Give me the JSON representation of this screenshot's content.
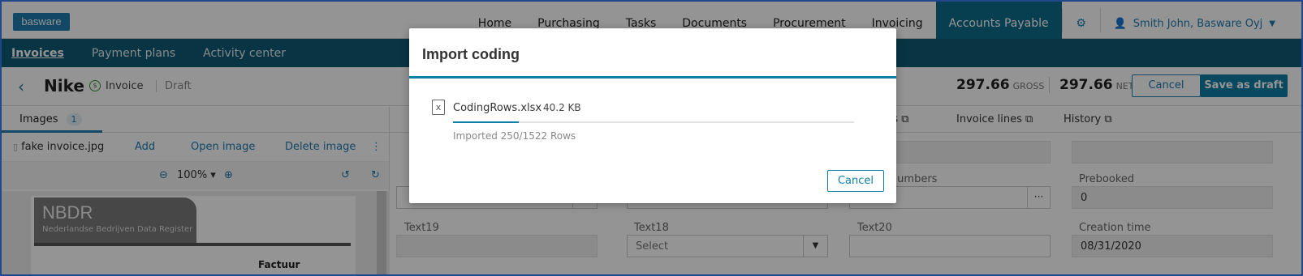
{
  "app": {
    "logo": "basware"
  },
  "topnav": {
    "items": [
      "Home",
      "Purchasing",
      "Tasks",
      "Documents",
      "Procurement",
      "Invoicing",
      "Accounts Payable"
    ],
    "active": "Accounts Payable",
    "user": "Smith John, Basware Oyj"
  },
  "subnav": {
    "items": [
      "Invoices",
      "Payment plans",
      "Activity center"
    ]
  },
  "header": {
    "title": "Nike",
    "type": "Invoice",
    "state": "Draft",
    "gross_value": "297.66",
    "gross_label": "GROSS",
    "net_value": "297.66",
    "net_label": "NET",
    "cancel_label": "Cancel",
    "save_label": "Save as draft"
  },
  "left": {
    "tab_label": "Images",
    "tab_count": "1",
    "file_name": "fake invoice.jpg",
    "actions": {
      "add": "Add",
      "open": "Open image",
      "delete": "Delete image"
    },
    "zoom": "100%",
    "doc": {
      "logo_big": "NBDR",
      "logo_small": "Nederlandse Bedrijven Data Register",
      "heading": "Factuur"
    }
  },
  "right": {
    "tabs": [
      "nts",
      "Invoice lines",
      "History"
    ],
    "fields": {
      "purchase_order_label": "e order numbers",
      "prebooked_label": "Prebooked",
      "prebooked_value": "0",
      "text19_label": "Text19",
      "text18_label": "Text18",
      "text18_placeholder": "Select",
      "text20_label": "Text20",
      "creation_label": "Creation time",
      "creation_value": "08/31/2020"
    }
  },
  "modal": {
    "title": "Import coding",
    "file_name": "CodingRows.xlsx",
    "file_size": "40.2 KB",
    "progress_text": "Imported 250/1522 Rows",
    "progress_fraction": 0.164,
    "cancel_label": "Cancel"
  }
}
